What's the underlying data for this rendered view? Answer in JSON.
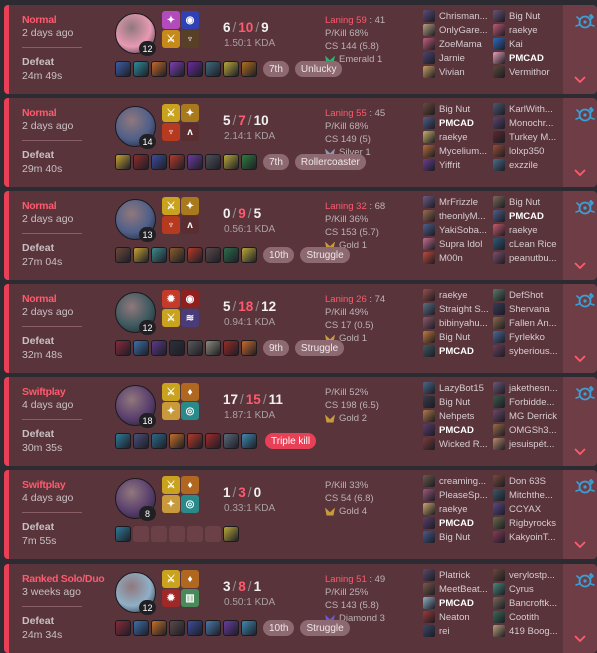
{
  "matches": [
    {
      "mode": "Normal",
      "ago": "2 days ago",
      "result": "Defeat",
      "duration": "24m 49s",
      "champ_color": "#e79ab3",
      "level": "12",
      "spells": [
        {
          "color": "#b34bbd",
          "glyph": "✦"
        },
        {
          "color": "#3040b5",
          "glyph": "◉"
        },
        {
          "color": "#c58a1a",
          "glyph": "⚔"
        },
        {
          "color": "#584026",
          "glyph": "♆"
        }
      ],
      "kills": "6",
      "deaths": "10",
      "assists": "9",
      "kda": "1.50:1 KDA",
      "lane": "Laning 59",
      "lane_rest": " : 41",
      "pkill": "P/Kill 68%",
      "cs": "CS 144 (5.8)",
      "rank": "Emerald 1",
      "rank_color": "#2bb371",
      "items": [
        "#3b5fa8",
        "#2c8c9a",
        "#c26a2a",
        "#7c3fb0",
        "#6b2a9b",
        "#3d6b7d",
        "#b7a83a",
        "#b06f1f"
      ],
      "badges": [
        {
          "text": "7th",
          "kind": "normal"
        },
        {
          "text": "Unlucky",
          "kind": "normal"
        }
      ],
      "team_a": [
        {
          "name": "Chrisman...",
          "c": "#5a4d7a"
        },
        {
          "name": "OnlyGare...",
          "c": "#b7a083"
        },
        {
          "name": "ZoeMama",
          "c": "#c25f7c"
        },
        {
          "name": "Jarnie",
          "c": "#4d4570"
        },
        {
          "name": "Vivian",
          "c": "#c8a062"
        }
      ],
      "team_b": [
        {
          "name": "Big Nut",
          "c": "#6c5477"
        },
        {
          "name": "raekye",
          "c": "#bd5b77"
        },
        {
          "name": "Kai",
          "c": "#2d6cc0"
        },
        {
          "name": "PMCAD",
          "c": "#e5a0b8",
          "me": true
        },
        {
          "name": "Vermithor",
          "c": "#5c4a3a"
        }
      ]
    },
    {
      "mode": "Normal",
      "ago": "2 days ago",
      "result": "Defeat",
      "duration": "29m 40s",
      "champ_color": "#4f5f89",
      "level": "14",
      "spells": [
        {
          "color": "#c9a21e",
          "glyph": "⚔"
        },
        {
          "color": "#a8791d",
          "glyph": "✦"
        },
        {
          "color": "#b63a1f",
          "glyph": "♆"
        },
        {
          "color": "#5a2e30",
          "glyph": "ʌ"
        }
      ],
      "kills": "5",
      "deaths": "7",
      "assists": "10",
      "kda": "2.14:1 KDA",
      "lane": "Laning 55",
      "lane_rest": " : 45",
      "pkill": "P/Kill 68%",
      "cs": "CS 149 (5)",
      "rank": "Silver 1",
      "rank_color": "#8a9aaa",
      "items": [
        "#c4a234",
        "#8d2c2a",
        "#3c4d9b",
        "#b53a2a",
        "#6c3ba0",
        "#4d5157",
        "#b7a83a",
        "#2f7c3b"
      ],
      "badges": [
        {
          "text": "7th",
          "kind": "normal"
        },
        {
          "text": "Rollercoaster",
          "kind": "normal"
        }
      ],
      "team_a": [
        {
          "name": "Big Nut",
          "c": "#6a4a3a"
        },
        {
          "name": "PMCAD",
          "c": "#4f5f89",
          "me": true
        },
        {
          "name": "raekye",
          "c": "#c7b06a"
        },
        {
          "name": "Mycelium...",
          "c": "#b86d39"
        },
        {
          "name": "Yiffrit",
          "c": "#6b3f8f"
        }
      ],
      "team_b": [
        {
          "name": "KarlWith...",
          "c": "#4b5a71"
        },
        {
          "name": "Monochr...",
          "c": "#5a4672"
        },
        {
          "name": "Turkey M...",
          "c": "#5d2a30"
        },
        {
          "name": "lolxp350",
          "c": "#9a4f35"
        },
        {
          "name": "exzzile",
          "c": "#4d6d8a"
        }
      ]
    },
    {
      "mode": "Normal",
      "ago": "2 days ago",
      "result": "Defeat",
      "duration": "27m 04s",
      "champ_color": "#4f5f89",
      "level": "13",
      "spells": [
        {
          "color": "#c9a21e",
          "glyph": "⚔"
        },
        {
          "color": "#a8791d",
          "glyph": "✦"
        },
        {
          "color": "#b63a1f",
          "glyph": "♆"
        },
        {
          "color": "#5a2e30",
          "glyph": "ʌ"
        }
      ],
      "kills": "0",
      "deaths": "9",
      "assists": "5",
      "kda": "0.56:1 KDA",
      "lane": "Laning 32",
      "lane_rest": " : 68",
      "pkill": "P/Kill 36%",
      "cs": "CS 153 (5.7)",
      "rank": "Gold 1",
      "rank_color": "#c99a3b",
      "items": [
        "#6b4a3a",
        "#c4a234",
        "#3c8a8a",
        "#8a5d2b",
        "#b53a2a",
        "#5a4a4a",
        "#2c6d4c",
        "#b7a83a"
      ],
      "badges": [
        {
          "text": "10th",
          "kind": "normal"
        },
        {
          "text": "Struggle",
          "kind": "normal"
        }
      ],
      "team_a": [
        {
          "name": "MrFrizzle",
          "c": "#6f5b84"
        },
        {
          "name": "theonlyM...",
          "c": "#9b6d4e"
        },
        {
          "name": "YakiSoba...",
          "c": "#4f5f89"
        },
        {
          "name": "Supra Idol",
          "c": "#c46d8d"
        },
        {
          "name": "M00n",
          "c": "#bf4a3b"
        }
      ],
      "team_b": [
        {
          "name": "Big Nut",
          "c": "#7c6a5a"
        },
        {
          "name": "PMCAD",
          "c": "#4f5f89",
          "me": true
        },
        {
          "name": "raekye",
          "c": "#c85b6b"
        },
        {
          "name": "cLean Rice",
          "c": "#2f5a7a"
        },
        {
          "name": "peanutbu...",
          "c": "#7c4f6b"
        }
      ]
    },
    {
      "mode": "Normal",
      "ago": "2 days ago",
      "result": "Defeat",
      "duration": "32m 48s",
      "champ_color": "#3d5a5f",
      "level": "12",
      "spells": [
        {
          "color": "#c63a2a",
          "glyph": "✹"
        },
        {
          "color": "#902020",
          "glyph": "◉"
        },
        {
          "color": "#c9a21e",
          "glyph": "⚔"
        },
        {
          "color": "#4a3b7a",
          "glyph": "≋"
        }
      ],
      "kills": "5",
      "deaths": "18",
      "assists": "12",
      "kda": "0.94:1 KDA",
      "lane": "Laning 26",
      "lane_rest": " : 74",
      "pkill": "P/Kill 49%",
      "cs": "CS 17 (0.5)",
      "rank": "Gold 1",
      "rank_color": "#c99a3b",
      "items": [
        "#8a2a3a",
        "#3d6fa8",
        "#5b3a8a",
        "#2c2f3a",
        "#5a5a5a",
        "#8b8b7a",
        "#9a2a24",
        "#c96a2a"
      ],
      "badges": [
        {
          "text": "9th",
          "kind": "normal"
        },
        {
          "text": "Struggle",
          "kind": "normal"
        }
      ],
      "team_a": [
        {
          "name": "raekye",
          "c": "#9a4f4a"
        },
        {
          "name": "Straight S...",
          "c": "#5d6f85"
        },
        {
          "name": "bibinyahu...",
          "c": "#8d5a6b"
        },
        {
          "name": "Big Nut",
          "c": "#c47a3a"
        },
        {
          "name": "PMCAD",
          "c": "#3d5a5f",
          "me": true
        }
      ],
      "team_b": [
        {
          "name": "DefShot",
          "c": "#5a7a6a"
        },
        {
          "name": "Shervana",
          "c": "#3a3a5a"
        },
        {
          "name": "Fallen An...",
          "c": "#8a6a4a"
        },
        {
          "name": "Fyrlekko",
          "c": "#4a6a9a"
        },
        {
          "name": "syberious...",
          "c": "#6a3f5a"
        }
      ]
    },
    {
      "mode": "Swiftplay",
      "ago": "4 days ago",
      "result": "Defeat",
      "duration": "30m 35s",
      "champ_color": "#5a3f6e",
      "level": "18",
      "spells": [
        {
          "color": "#c9a21e",
          "glyph": "⚔"
        },
        {
          "color": "#b06820",
          "glyph": "♦"
        },
        {
          "color": "#c99a3b",
          "glyph": "✦"
        },
        {
          "color": "#2a8a8a",
          "glyph": "◎"
        }
      ],
      "kills": "17",
      "deaths": "15",
      "assists": "11",
      "kda": "1.87:1 KDA",
      "lane": "",
      "lane_rest": "",
      "pkill": "P/Kill 52%",
      "cs": "CS 198 (6.5)",
      "rank": "Gold 2",
      "rank_color": "#c99a3b",
      "items": [
        "#2c7c9a",
        "#4a4f7a",
        "#2a6b8a",
        "#c4702a",
        "#b53a2a",
        "#a02a2a",
        "#5a6a7a",
        "#3d8ab0"
      ],
      "badges": [
        {
          "text": "Triple kill",
          "kind": "mk"
        }
      ],
      "team_a": [
        {
          "name": "LazyBot15",
          "c": "#4a6a8a"
        },
        {
          "name": "Big Nut",
          "c": "#3a3a4a"
        },
        {
          "name": "Nehpets",
          "c": "#b07a4a"
        },
        {
          "name": "PMCAD",
          "c": "#5a3f6e",
          "me": true
        },
        {
          "name": "Wicked R...",
          "c": "#7a3a3a"
        }
      ],
      "team_b": [
        {
          "name": "jakethesn...",
          "c": "#6a5a7a"
        },
        {
          "name": "Forbidde...",
          "c": "#3a5a4a"
        },
        {
          "name": "MG Derrick",
          "c": "#6a4a6a"
        },
        {
          "name": "OMGSh3...",
          "c": "#9a6a4a"
        },
        {
          "name": "jesuispét...",
          "c": "#b88a6a"
        }
      ]
    },
    {
      "mode": "Swiftplay",
      "ago": "4 days ago",
      "result": "Defeat",
      "duration": "7m 55s",
      "champ_color": "#5a3f6e",
      "level": "8",
      "spells": [
        {
          "color": "#c9a21e",
          "glyph": "⚔"
        },
        {
          "color": "#b06820",
          "glyph": "♦"
        },
        {
          "color": "#c99a3b",
          "glyph": "✦"
        },
        {
          "color": "#2a8a8a",
          "glyph": "◎"
        }
      ],
      "kills": "1",
      "deaths": "3",
      "assists": "0",
      "kda": "0.33:1 KDA",
      "lane": "",
      "lane_rest": "",
      "pkill": "P/Kill 33%",
      "cs": "CS 54 (6.8)",
      "rank": "Gold 4",
      "rank_color": "#c99a3b",
      "items": [
        "#2c7c9a",
        "empty",
        "empty",
        "empty",
        "empty",
        "empty",
        "#b7a83a"
      ],
      "badges": [],
      "team_a": [
        {
          "name": "creaming...",
          "c": "#6a5a4a"
        },
        {
          "name": "PleaseSp...",
          "c": "#9a5a7a"
        },
        {
          "name": "raekye",
          "c": "#c8a86a"
        },
        {
          "name": "PMCAD",
          "c": "#5a3f6e",
          "me": true
        },
        {
          "name": "Big Nut",
          "c": "#4a5a8a"
        }
      ],
      "team_b": [
        {
          "name": "Don 63S",
          "c": "#7a4a3a"
        },
        {
          "name": "Mitchthe...",
          "c": "#3a5a6a"
        },
        {
          "name": "CCYAX",
          "c": "#5a4a8a"
        },
        {
          "name": "Rigbyrocks",
          "c": "#6a6a4a"
        },
        {
          "name": "KakyoinT...",
          "c": "#8a3a5a"
        }
      ]
    },
    {
      "mode": "Ranked Solo/Duo",
      "ago": "3 weeks ago",
      "result": "Defeat",
      "duration": "24m 34s",
      "champ_color": "#8fb0c7",
      "level": "12",
      "spells": [
        {
          "color": "#c9a21e",
          "glyph": "⚔"
        },
        {
          "color": "#b06820",
          "glyph": "♦"
        },
        {
          "color": "#a02828",
          "glyph": "✹"
        },
        {
          "color": "#4a8a5a",
          "glyph": "▥"
        }
      ],
      "kills": "3",
      "deaths": "8",
      "assists": "1",
      "kda": "0.50:1 KDA",
      "lane": "Laning 51",
      "lane_rest": " : 49",
      "pkill": "P/Kill 25%",
      "cs": "CS 143 (5.8)",
      "rank": "Diamond 3",
      "rank_color": "#6a56d6",
      "items": [
        "#8a2a3a",
        "#3d6fa8",
        "#c4702a",
        "#5a4a4a",
        "#3c4d9b",
        "#4a7aa8",
        "#6a3ba0",
        "#3d8ab0"
      ],
      "badges": [
        {
          "text": "10th",
          "kind": "normal"
        },
        {
          "text": "Struggle",
          "kind": "normal"
        }
      ],
      "team_a": [
        {
          "name": "Platrick",
          "c": "#5a4a6a"
        },
        {
          "name": "MeetBeat...",
          "c": "#7a5a4a"
        },
        {
          "name": "PMCAD",
          "c": "#8fb0c7",
          "me": true
        },
        {
          "name": "Neaton",
          "c": "#9a3a3a"
        },
        {
          "name": "rei",
          "c": "#3a4a6a"
        }
      ],
      "team_b": [
        {
          "name": "verylostp...",
          "c": "#6a4a3a"
        },
        {
          "name": "Cyrus",
          "c": "#4a8a7a"
        },
        {
          "name": "Bancroftk...",
          "c": "#7a6a5a"
        },
        {
          "name": "Cootith",
          "c": "#3a6a5a"
        },
        {
          "name": "419 Boog...",
          "c": "#b8a07a"
        }
      ]
    }
  ]
}
